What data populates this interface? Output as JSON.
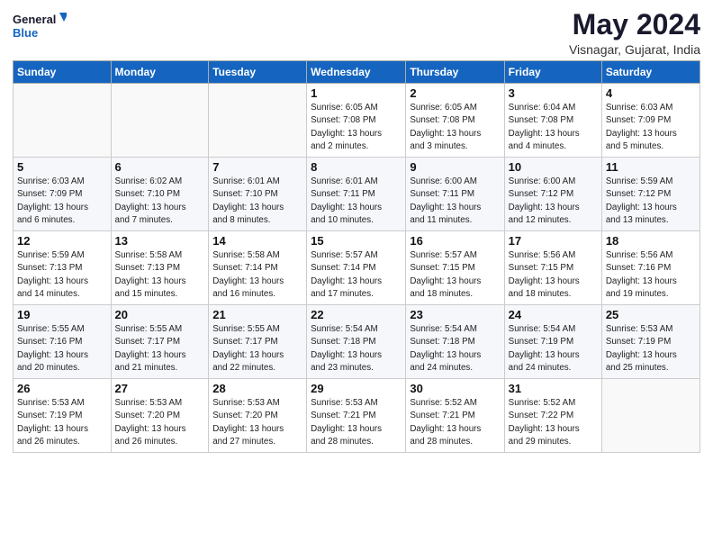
{
  "header": {
    "logo_line1": "General",
    "logo_line2": "Blue",
    "title": "May 2024",
    "subtitle": "Visnagar, Gujarat, India"
  },
  "weekdays": [
    "Sunday",
    "Monday",
    "Tuesday",
    "Wednesday",
    "Thursday",
    "Friday",
    "Saturday"
  ],
  "weeks": [
    [
      {
        "day": "",
        "info": ""
      },
      {
        "day": "",
        "info": ""
      },
      {
        "day": "",
        "info": ""
      },
      {
        "day": "1",
        "info": "Sunrise: 6:05 AM\nSunset: 7:08 PM\nDaylight: 13 hours\nand 2 minutes."
      },
      {
        "day": "2",
        "info": "Sunrise: 6:05 AM\nSunset: 7:08 PM\nDaylight: 13 hours\nand 3 minutes."
      },
      {
        "day": "3",
        "info": "Sunrise: 6:04 AM\nSunset: 7:08 PM\nDaylight: 13 hours\nand 4 minutes."
      },
      {
        "day": "4",
        "info": "Sunrise: 6:03 AM\nSunset: 7:09 PM\nDaylight: 13 hours\nand 5 minutes."
      }
    ],
    [
      {
        "day": "5",
        "info": "Sunrise: 6:03 AM\nSunset: 7:09 PM\nDaylight: 13 hours\nand 6 minutes."
      },
      {
        "day": "6",
        "info": "Sunrise: 6:02 AM\nSunset: 7:10 PM\nDaylight: 13 hours\nand 7 minutes."
      },
      {
        "day": "7",
        "info": "Sunrise: 6:01 AM\nSunset: 7:10 PM\nDaylight: 13 hours\nand 8 minutes."
      },
      {
        "day": "8",
        "info": "Sunrise: 6:01 AM\nSunset: 7:11 PM\nDaylight: 13 hours\nand 10 minutes."
      },
      {
        "day": "9",
        "info": "Sunrise: 6:00 AM\nSunset: 7:11 PM\nDaylight: 13 hours\nand 11 minutes."
      },
      {
        "day": "10",
        "info": "Sunrise: 6:00 AM\nSunset: 7:12 PM\nDaylight: 13 hours\nand 12 minutes."
      },
      {
        "day": "11",
        "info": "Sunrise: 5:59 AM\nSunset: 7:12 PM\nDaylight: 13 hours\nand 13 minutes."
      }
    ],
    [
      {
        "day": "12",
        "info": "Sunrise: 5:59 AM\nSunset: 7:13 PM\nDaylight: 13 hours\nand 14 minutes."
      },
      {
        "day": "13",
        "info": "Sunrise: 5:58 AM\nSunset: 7:13 PM\nDaylight: 13 hours\nand 15 minutes."
      },
      {
        "day": "14",
        "info": "Sunrise: 5:58 AM\nSunset: 7:14 PM\nDaylight: 13 hours\nand 16 minutes."
      },
      {
        "day": "15",
        "info": "Sunrise: 5:57 AM\nSunset: 7:14 PM\nDaylight: 13 hours\nand 17 minutes."
      },
      {
        "day": "16",
        "info": "Sunrise: 5:57 AM\nSunset: 7:15 PM\nDaylight: 13 hours\nand 18 minutes."
      },
      {
        "day": "17",
        "info": "Sunrise: 5:56 AM\nSunset: 7:15 PM\nDaylight: 13 hours\nand 18 minutes."
      },
      {
        "day": "18",
        "info": "Sunrise: 5:56 AM\nSunset: 7:16 PM\nDaylight: 13 hours\nand 19 minutes."
      }
    ],
    [
      {
        "day": "19",
        "info": "Sunrise: 5:55 AM\nSunset: 7:16 PM\nDaylight: 13 hours\nand 20 minutes."
      },
      {
        "day": "20",
        "info": "Sunrise: 5:55 AM\nSunset: 7:17 PM\nDaylight: 13 hours\nand 21 minutes."
      },
      {
        "day": "21",
        "info": "Sunrise: 5:55 AM\nSunset: 7:17 PM\nDaylight: 13 hours\nand 22 minutes."
      },
      {
        "day": "22",
        "info": "Sunrise: 5:54 AM\nSunset: 7:18 PM\nDaylight: 13 hours\nand 23 minutes."
      },
      {
        "day": "23",
        "info": "Sunrise: 5:54 AM\nSunset: 7:18 PM\nDaylight: 13 hours\nand 24 minutes."
      },
      {
        "day": "24",
        "info": "Sunrise: 5:54 AM\nSunset: 7:19 PM\nDaylight: 13 hours\nand 24 minutes."
      },
      {
        "day": "25",
        "info": "Sunrise: 5:53 AM\nSunset: 7:19 PM\nDaylight: 13 hours\nand 25 minutes."
      }
    ],
    [
      {
        "day": "26",
        "info": "Sunrise: 5:53 AM\nSunset: 7:19 PM\nDaylight: 13 hours\nand 26 minutes."
      },
      {
        "day": "27",
        "info": "Sunrise: 5:53 AM\nSunset: 7:20 PM\nDaylight: 13 hours\nand 26 minutes."
      },
      {
        "day": "28",
        "info": "Sunrise: 5:53 AM\nSunset: 7:20 PM\nDaylight: 13 hours\nand 27 minutes."
      },
      {
        "day": "29",
        "info": "Sunrise: 5:53 AM\nSunset: 7:21 PM\nDaylight: 13 hours\nand 28 minutes."
      },
      {
        "day": "30",
        "info": "Sunrise: 5:52 AM\nSunset: 7:21 PM\nDaylight: 13 hours\nand 28 minutes."
      },
      {
        "day": "31",
        "info": "Sunrise: 5:52 AM\nSunset: 7:22 PM\nDaylight: 13 hours\nand 29 minutes."
      },
      {
        "day": "",
        "info": ""
      }
    ]
  ]
}
